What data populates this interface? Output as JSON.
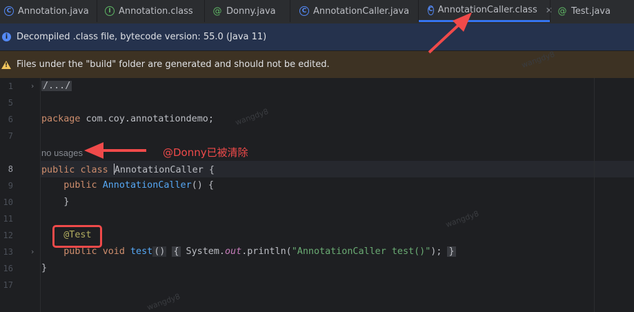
{
  "tabs": [
    {
      "label": "Annotation.java",
      "icon": "class-icon"
    },
    {
      "label": "Annotation.class",
      "icon": "interface-icon"
    },
    {
      "label": "Donny.java",
      "icon": "annotation-icon"
    },
    {
      "label": "AnnotationCaller.java",
      "icon": "class-icon"
    },
    {
      "label": "AnnotationCaller.class",
      "icon": "class-icon",
      "active": true
    },
    {
      "label": "Test.java",
      "icon": "annotation-icon"
    }
  ],
  "banners": {
    "decompiled": "Decompiled .class file, bytecode version: 55.0 (Java 11)",
    "build_warning": "Files under the \"build\" folder are generated and should not be edited."
  },
  "editor": {
    "line_numbers": [
      "1",
      "5",
      "6",
      "7",
      "8",
      "9",
      "10",
      "11",
      "12",
      "13",
      "16",
      "17"
    ],
    "current_line": "8",
    "folded_import": "/.../",
    "package_kw": "package",
    "package_name": " com.coy.annotationdemo;",
    "usage_hint": "no usages",
    "class_decl": {
      "public": "public",
      "class": "class",
      "name": "AnnotationCaller",
      "brace": " {"
    },
    "ctor": {
      "public": "public",
      "name": "AnnotationCaller",
      "rest": "() {"
    },
    "ctor_close": "}",
    "annotation": "@Test",
    "method": {
      "public": "public",
      "void": "void",
      "name": "test",
      "parens": "()",
      "open": "{",
      "sys": " System.",
      "out": "out",
      "println": ".println(",
      "str": "\"AnnotationCaller test()\"",
      "end": ");",
      "close": "}"
    },
    "class_close": "}"
  },
  "annotations": {
    "note": "@Donny已被清除"
  },
  "watermark": "wangdy8",
  "colors": {
    "accent": "#3574f0",
    "annotation_red": "#f04a4a",
    "keyword": "#cf8e6d",
    "function": "#56a8f5",
    "string": "#6aab73"
  }
}
